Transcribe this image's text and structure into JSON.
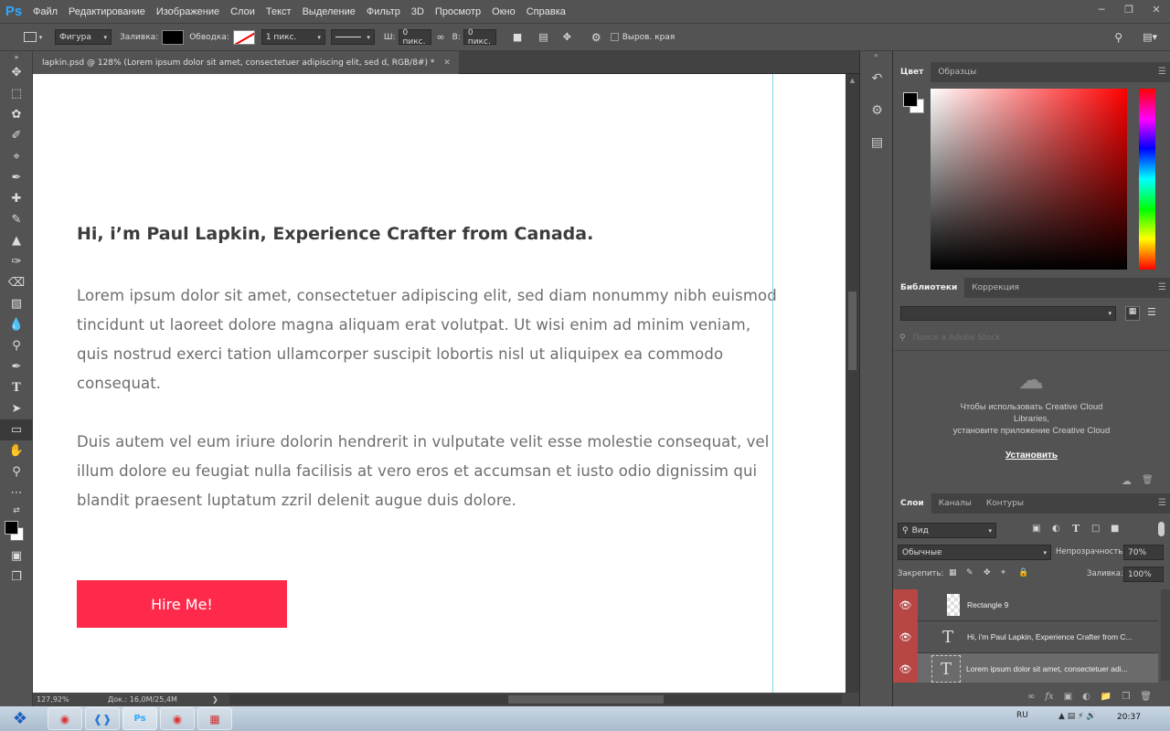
{
  "app": {
    "logo": "Ps"
  },
  "menu": [
    "Файл",
    "Редактирование",
    "Изображение",
    "Слои",
    "Текст",
    "Выделение",
    "Фильтр",
    "3D",
    "Просмотр",
    "Окно",
    "Справка"
  ],
  "options": {
    "shape_mode": "Фигура",
    "fill_label": "Заливка:",
    "stroke_label": "Обводка:",
    "stroke_size": "1 пикс.",
    "w_label": "Ш:",
    "w_value": "0 пикс.",
    "h_label": "В:",
    "h_value": "0 пикс.",
    "align_edges": "Выров. края"
  },
  "document": {
    "tab_title": "lapkin.psd @ 128% (Lorem ipsum dolor sit amet, consectetuer adipiscing elit, sed d, RGB/8#) *",
    "heading": "Hi, i’m Paul Lapkin, Experience Crafter from Canada.",
    "paragraph1": "Lorem ipsum dolor sit amet, consectetuer adipiscing elit, sed diam nonummy nibh euismod tincidunt ut laoreet dolore magna aliquam erat volutpat. Ut wisi enim ad minim veniam, quis nostrud exerci tation ullamcorper suscipit lobortis nisl ut aliquipex ea commodo consequat.",
    "paragraph2": "Duis autem vel eum iriure dolorin hendrerit in vulputate velit esse molestie consequat, vel illum dolore eu feugiat nulla facilisis at vero eros et accumsan et iusto odio dignissim qui blandit praesent luptatum zzril delenit augue duis dolore.",
    "button_label": "Hire Me!"
  },
  "status": {
    "zoom": "127,92%",
    "doc_size": "Док.: 16,0M/25,4M"
  },
  "color_panel": {
    "tabs": [
      "Цвет",
      "Образцы"
    ]
  },
  "libraries_panel": {
    "tabs": [
      "Библиотеки",
      "Коррекция"
    ],
    "search_placeholder": "Поиск в Adobe Stock",
    "message_line1": "Чтобы использовать Creative Cloud",
    "message_line2": "Libraries,",
    "message_line3": "установите приложение Creative Cloud",
    "install": "Установить"
  },
  "layers_panel": {
    "tabs": [
      "Слои",
      "Каналы",
      "Контуры"
    ],
    "filter": "Вид",
    "blend_mode": "Обычные",
    "opacity_label": "Непрозрачность:",
    "opacity": "70%",
    "lock_label": "Закрепить:",
    "fill_label": "Заливка:",
    "fill": "100%",
    "layers": [
      {
        "name": "Rectangle 9"
      },
      {
        "name": "Hi, i'm Paul Lapkin, Experience Crafter from C..."
      },
      {
        "name": "Lorem ipsum dolor sit amet, consectetuer adi..."
      }
    ]
  },
  "taskbar": {
    "lang": "RU",
    "time": "20:37"
  },
  "colors": {
    "accent_button": "#ff2a4b",
    "layer_eye": "#b74644",
    "guide": "#7ed8e0"
  }
}
